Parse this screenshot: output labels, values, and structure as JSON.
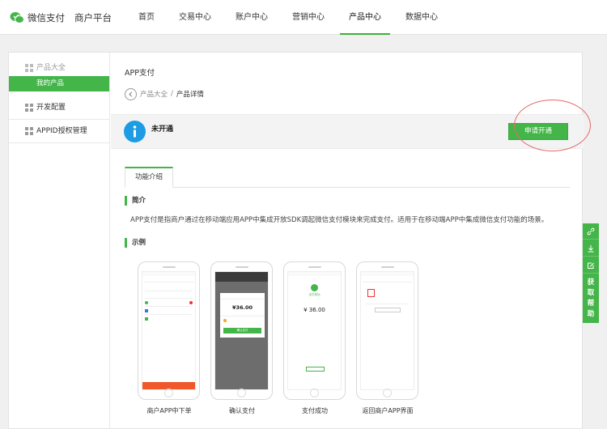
{
  "header": {
    "brand": "微信支付",
    "platform": "商户平台",
    "nav": [
      {
        "label": "首页"
      },
      {
        "label": "交易中心"
      },
      {
        "label": "账户中心"
      },
      {
        "label": "营销中心"
      },
      {
        "label": "产品中心",
        "active": true
      },
      {
        "label": "数据中心"
      }
    ]
  },
  "sidebar": {
    "product_group": "产品大全",
    "my_products": "我的产品",
    "dev_config": "开发配置",
    "appid_auth": "APPID授权管理"
  },
  "main": {
    "title": "APP支付",
    "breadcrumb": {
      "parent": "产品大全",
      "separator": "/",
      "current": "产品详情"
    },
    "status": "未开通",
    "apply_button": "申请开通",
    "tab": "功能介绍",
    "intro_title": "简介",
    "intro_text": "APP支付是指商户通过在移动端应用APP中集成开放SDK调起微信支付模块来完成支付。适用于在移动端APP中集成微信支付功能的场景。",
    "example_title": "示例",
    "examples": [
      {
        "caption": "商户APP中下单"
      },
      {
        "caption": "确认支付"
      },
      {
        "caption": "支付成功"
      },
      {
        "caption": "返回商户APP界面"
      }
    ],
    "phone_amount": "¥36.00",
    "phone_amount_spaced": "¥ 36.00",
    "phone_confirm": "确认支付",
    "phone_paid": "支付成功"
  },
  "float_help": {
    "label": "获取帮助"
  },
  "colors": {
    "accent": "#44b549",
    "info": "#1d9be3",
    "ring": "#e46a6a"
  }
}
